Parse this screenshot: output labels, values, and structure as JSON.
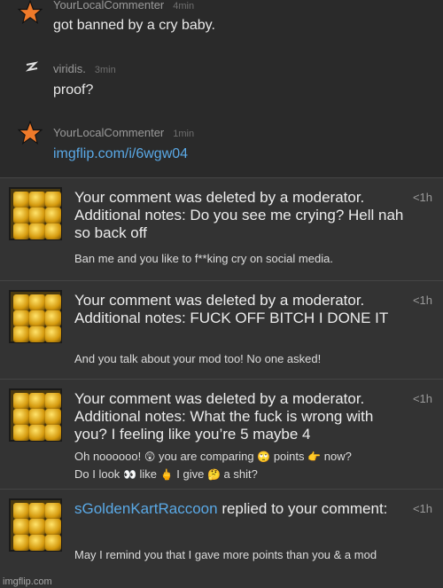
{
  "thread": {
    "comments": [
      {
        "author": "YourLocalCommenter",
        "age": "4min",
        "text": "got banned by a cry baby."
      },
      {
        "author": "viridis.",
        "age": "3min",
        "text": "proof?"
      },
      {
        "author": "YourLocalCommenter",
        "age": "1min",
        "text": "imgflip.com/i/6wgw04"
      }
    ]
  },
  "notifications": [
    {
      "title": "Your comment was deleted by a moderator. Additional notes: Do you see me crying? Hell nah so back off",
      "body": "Ban me and you like to f**king cry on social media.",
      "time": "<1h"
    },
    {
      "title": "Your comment was deleted by a moderator. Additional notes: FUCK OFF BITCH I DONE IT",
      "body": "And you talk about your mod too! No one asked!",
      "time": "<1h"
    },
    {
      "title": "Your comment was deleted by a moderator. Additional notes: What the fuck is wrong with you? I feeling like you’re 5 maybe 4",
      "body_parts": [
        "Oh noooooo!",
        "you are comparing",
        "points",
        "now?",
        "Do I look",
        "like",
        "I give",
        "a shit?"
      ],
      "time": "<1h"
    },
    {
      "username": "sGoldenKartRaccoon",
      "title_rest": " replied to your comment:",
      "body": "May I remind you that I gave more points than you & a mod",
      "time": "<1h"
    }
  ],
  "watermark": "imgflip.com",
  "colors": {
    "link": "#5aa9e6",
    "star": "#f07a2a"
  }
}
